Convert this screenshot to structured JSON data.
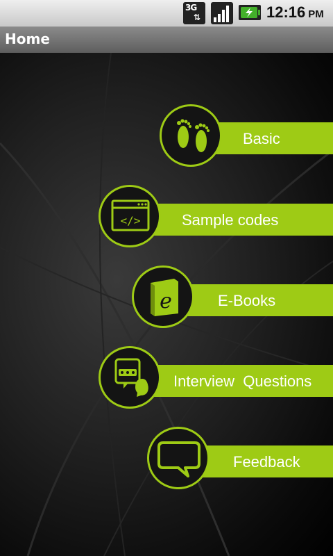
{
  "status_bar": {
    "network_label": "3G",
    "network_arrows": "⇅",
    "time": "12:16",
    "ampm": "PM",
    "signal_icon": "signal-bars-icon",
    "battery_icon": "battery-charging-icon"
  },
  "title_bar": {
    "title": "Home"
  },
  "menu": {
    "accent_color": "#9ecb15",
    "items": [
      {
        "label": "Basic",
        "icon": "footprints-icon"
      },
      {
        "label": "Sample codes",
        "icon": "code-window-icon"
      },
      {
        "label": "E-Books",
        "icon": "ebook-icon"
      },
      {
        "label": "Interview  Questions",
        "icon": "interview-chat-icon"
      },
      {
        "label": "Feedback",
        "icon": "speech-bubble-icon"
      }
    ]
  }
}
